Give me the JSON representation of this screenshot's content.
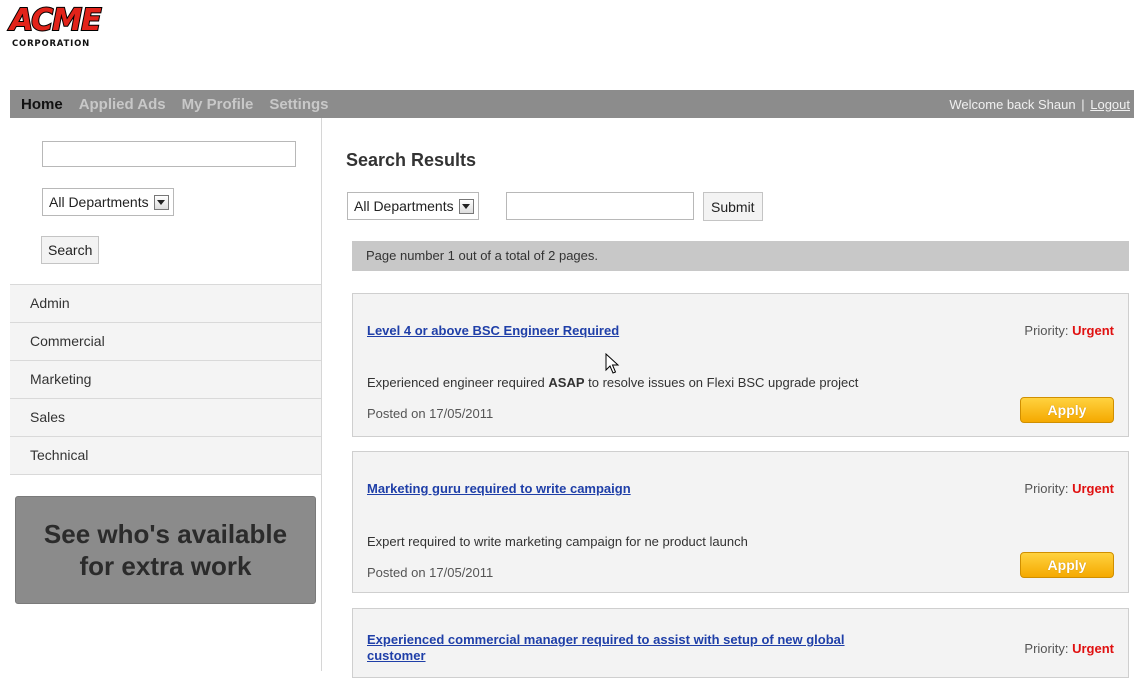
{
  "logo": {
    "wordmark": "ACME",
    "subtitle": "CORPORATION"
  },
  "nav": {
    "items": [
      "Home",
      "Applied Ads",
      "My Profile",
      "Settings"
    ],
    "welcome": "Welcome back Shaun",
    "separator": "|",
    "logout": "Logout"
  },
  "sidebar": {
    "search_value": "",
    "dept_selected": "All Departments",
    "search_button": "Search",
    "departments": [
      "Admin",
      "Commercial",
      "Marketing",
      "Sales",
      "Technical"
    ],
    "promo_line1": "See who's available",
    "promo_line2": "for extra work"
  },
  "main": {
    "title": "Search Results",
    "dept_selected": "All Departments",
    "search_value": "",
    "submit_button": "Submit",
    "page_info": "Page number 1 out of a total of 2 pages.",
    "priority_label": "Priority:",
    "jobs": [
      {
        "title": "Level 4 or above BSC Engineer Required",
        "priority": "Urgent",
        "desc_before": "Experienced engineer required ",
        "desc_bold": "ASAP",
        "desc_after": " to resolve issues on Flexi BSC upgrade project",
        "posted": "Posted on 17/05/2011",
        "apply": "Apply"
      },
      {
        "title": "Marketing guru required to write campaign",
        "priority": "Urgent",
        "desc_before": "Expert required to write marketing campaign for ne product launch",
        "desc_bold": "",
        "desc_after": "",
        "posted": "Posted on 17/05/2011",
        "apply": "Apply"
      },
      {
        "title_line1": "Experienced commercial manager required to assist with setup of new global",
        "title_line2": "customer",
        "priority": "Urgent"
      }
    ]
  },
  "colors": {
    "nav_bg": "#8c8c8c",
    "urgent": "#e01010",
    "link": "#1f3fa8",
    "apply": "#f5a900"
  }
}
